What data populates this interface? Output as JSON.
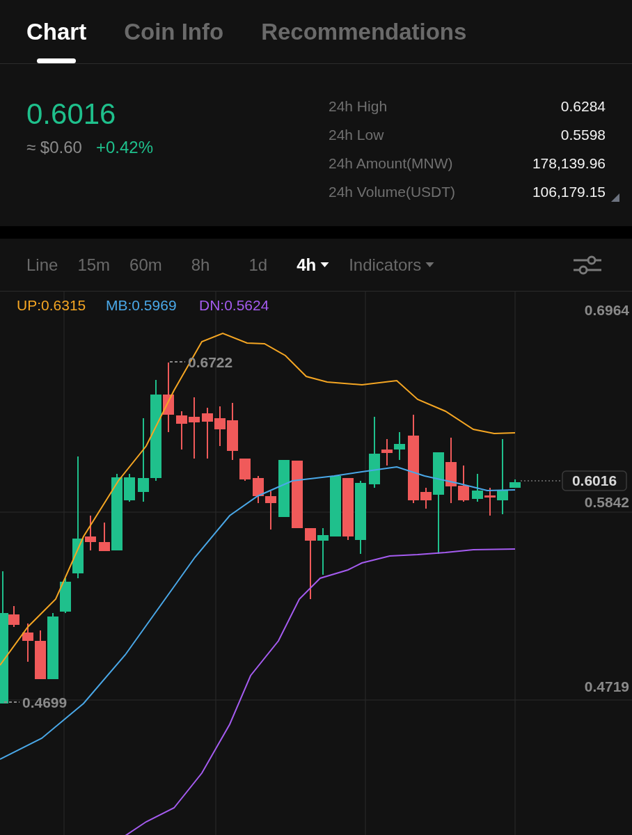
{
  "tabs": [
    {
      "label": "Chart",
      "selected": true
    },
    {
      "label": "Coin Info",
      "selected": false
    },
    {
      "label": "Recommendations",
      "selected": false
    }
  ],
  "price": {
    "last": "0.6016",
    "usd": "≈ $0.60",
    "change": "+0.42%"
  },
  "stats": [
    {
      "label": "24h High",
      "value": "0.6284"
    },
    {
      "label": "24h Low",
      "value": "0.5598"
    },
    {
      "label": "24h Amount(MNW)",
      "value": "178,139.96"
    },
    {
      "label": "24h Volume(USDT)",
      "value": "106,179.15"
    }
  ],
  "intervals": [
    {
      "label": "Line",
      "selected": false,
      "has_menu": false
    },
    {
      "label": "15m",
      "selected": false,
      "has_menu": false
    },
    {
      "label": "60m",
      "selected": false,
      "has_menu": false
    },
    {
      "label": "8h",
      "selected": false,
      "has_menu": false
    },
    {
      "label": "1d",
      "selected": false,
      "has_menu": false
    },
    {
      "label": "4h",
      "selected": true,
      "has_menu": true
    },
    {
      "label": "Indicators",
      "selected": false,
      "has_menu": true
    }
  ],
  "chart": {
    "legend": [
      {
        "label": "UP:0.6315",
        "color": "#f5a623"
      },
      {
        "label": "MB:0.5969",
        "color": "#4aa8e8"
      },
      {
        "label": "DN:0.5624",
        "color": "#a55cf0"
      }
    ],
    "axis_labels": [
      "0.6964",
      "0.5842",
      "0.4719"
    ],
    "high_marker": "0.6722",
    "low_marker": "0.4699",
    "current_price": "0.6016"
  }
}
